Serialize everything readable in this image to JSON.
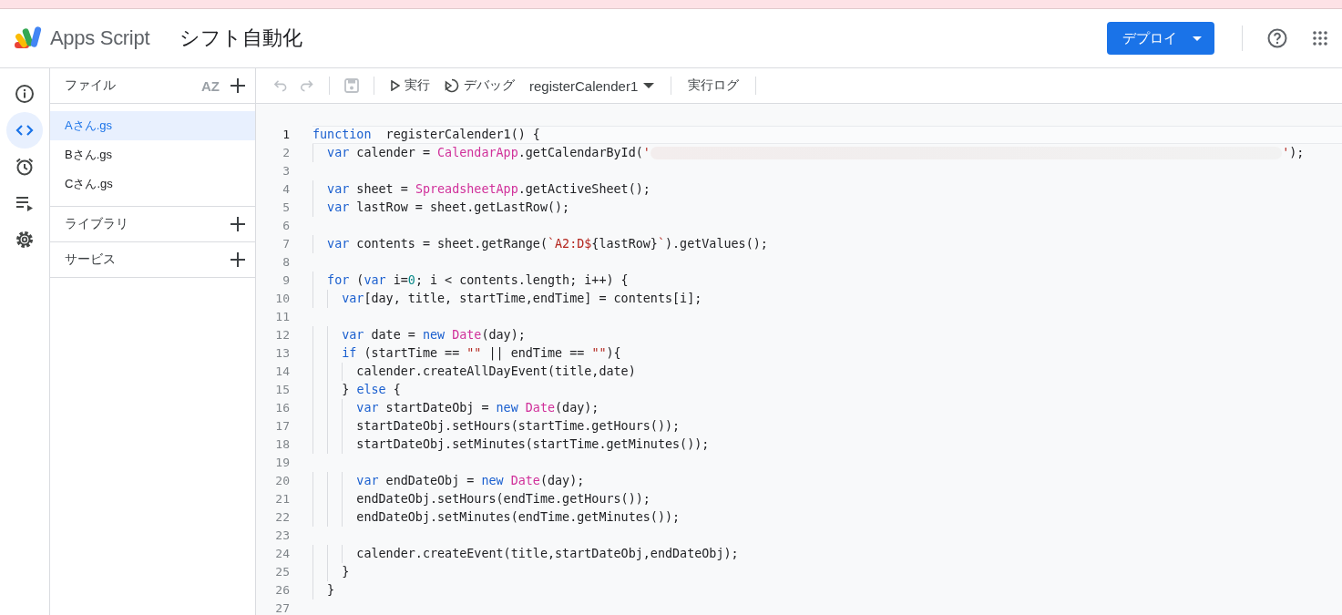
{
  "header": {
    "product": "Apps Script",
    "project_title": "シフト自動化",
    "deploy_button": "デプロイ"
  },
  "rail": [
    {
      "kind": "info",
      "selected": false
    },
    {
      "kind": "code",
      "selected": true
    },
    {
      "kind": "triggers",
      "selected": false
    },
    {
      "kind": "executions",
      "selected": false
    },
    {
      "kind": "settings",
      "selected": false
    }
  ],
  "files_panel": {
    "title": "ファイル",
    "sort_label": "AZ",
    "files": [
      {
        "name": "Aさん.gs",
        "selected": true
      },
      {
        "name": "Bさん.gs",
        "selected": false
      },
      {
        "name": "Cさん.gs",
        "selected": false
      }
    ],
    "sections": [
      {
        "title": "ライブラリ"
      },
      {
        "title": "サービス"
      }
    ]
  },
  "toolbar": {
    "run": "実行",
    "debug": "デバッグ",
    "function_select": "registerCalender1",
    "log": "実行ログ"
  },
  "editor": {
    "lines": [
      {
        "number": "1",
        "current": true,
        "tokens": [
          {
            "kind": "kw",
            "text": "function"
          },
          {
            "kind": "pl",
            "text": "  registerCalender1() {"
          }
        ]
      },
      {
        "number": "2",
        "current": false,
        "tokens": [
          {
            "kind": "kw",
            "text": "  var"
          },
          {
            "kind": "pl",
            "text": " calender = "
          },
          {
            "kind": "cls",
            "text": "CalendarApp"
          },
          {
            "kind": "pl",
            "text": ".getCalendarById("
          },
          {
            "kind": "str",
            "text": "'"
          },
          {
            "kind": "redacted"
          },
          {
            "kind": "str",
            "text": "'"
          },
          {
            "kind": "pl",
            "text": ");"
          }
        ]
      },
      {
        "number": "3",
        "current": false
      },
      {
        "number": "4",
        "current": false,
        "tokens": [
          {
            "kind": "kw",
            "text": "  var"
          },
          {
            "kind": "pl",
            "text": " sheet = "
          },
          {
            "kind": "cls",
            "text": "SpreadsheetApp"
          },
          {
            "kind": "pl",
            "text": ".getActiveSheet();"
          }
        ]
      },
      {
        "number": "5",
        "current": false,
        "tokens": [
          {
            "kind": "kw",
            "text": "  var"
          },
          {
            "kind": "pl",
            "text": " lastRow = sheet.getLastRow();"
          }
        ]
      },
      {
        "number": "6",
        "current": false
      },
      {
        "number": "7",
        "current": false,
        "tokens": [
          {
            "kind": "kw",
            "text": "  var"
          },
          {
            "kind": "pl",
            "text": " contents = sheet.getRange("
          },
          {
            "kind": "str",
            "text": "`A2:D$"
          },
          {
            "kind": "pl",
            "text": "{lastRow}"
          },
          {
            "kind": "str",
            "text": "`"
          },
          {
            "kind": "pl",
            "text": ").getValues();"
          }
        ]
      },
      {
        "number": "8",
        "current": false
      },
      {
        "number": "9",
        "current": false,
        "tokens": [
          {
            "kind": "kw",
            "text": "  for"
          },
          {
            "kind": "pl",
            "text": " ("
          },
          {
            "kind": "kw",
            "text": "var"
          },
          {
            "kind": "pl",
            "text": " i="
          },
          {
            "kind": "num",
            "text": "0"
          },
          {
            "kind": "pl",
            "text": "; i < contents.length; i++) {"
          }
        ]
      },
      {
        "number": "10",
        "current": false,
        "tokens": [
          {
            "kind": "kw",
            "text": "    var"
          },
          {
            "kind": "pl",
            "text": "[day, title, startTime,endTime] = contents[i];"
          }
        ]
      },
      {
        "number": "11",
        "current": false
      },
      {
        "number": "12",
        "current": false,
        "tokens": [
          {
            "kind": "kw",
            "text": "    var"
          },
          {
            "kind": "pl",
            "text": " date = "
          },
          {
            "kind": "kw",
            "text": "new "
          },
          {
            "kind": "cls",
            "text": "Date"
          },
          {
            "kind": "pl",
            "text": "(day);"
          }
        ]
      },
      {
        "number": "13",
        "current": false,
        "tokens": [
          {
            "kind": "kw",
            "text": "    if"
          },
          {
            "kind": "pl",
            "text": " (startTime == "
          },
          {
            "kind": "str",
            "text": "\"\""
          },
          {
            "kind": "pl",
            "text": " || endTime == "
          },
          {
            "kind": "str",
            "text": "\"\""
          },
          {
            "kind": "pl",
            "text": "){"
          }
        ]
      },
      {
        "number": "14",
        "current": false,
        "tokens": [
          {
            "kind": "pl",
            "text": "      calender.createAllDayEvent(title,date)"
          }
        ]
      },
      {
        "number": "15",
        "current": false,
        "tokens": [
          {
            "kind": "pl",
            "text": "    } "
          },
          {
            "kind": "kw",
            "text": "else"
          },
          {
            "kind": "pl",
            "text": " {"
          }
        ]
      },
      {
        "number": "16",
        "current": false,
        "tokens": [
          {
            "kind": "kw",
            "text": "      var"
          },
          {
            "kind": "pl",
            "text": " startDateObj = "
          },
          {
            "kind": "kw",
            "text": "new "
          },
          {
            "kind": "cls",
            "text": "Date"
          },
          {
            "kind": "pl",
            "text": "(day);"
          }
        ]
      },
      {
        "number": "17",
        "current": false,
        "tokens": [
          {
            "kind": "pl",
            "text": "      startDateObj.setHours(startTime.getHours());"
          }
        ]
      },
      {
        "number": "18",
        "current": false,
        "tokens": [
          {
            "kind": "pl",
            "text": "      startDateObj.setMinutes(startTime.getMinutes());"
          }
        ]
      },
      {
        "number": "19",
        "current": false
      },
      {
        "number": "20",
        "current": false,
        "tokens": [
          {
            "kind": "kw",
            "text": "      var"
          },
          {
            "kind": "pl",
            "text": " endDateObj = "
          },
          {
            "kind": "kw",
            "text": "new "
          },
          {
            "kind": "cls",
            "text": "Date"
          },
          {
            "kind": "pl",
            "text": "(day);"
          }
        ]
      },
      {
        "number": "21",
        "current": false,
        "tokens": [
          {
            "kind": "pl",
            "text": "      endDateObj.setHours(endTime.getHours());"
          }
        ]
      },
      {
        "number": "22",
        "current": false,
        "tokens": [
          {
            "kind": "pl",
            "text": "      endDateObj.setMinutes(endTime.getMinutes());"
          }
        ]
      },
      {
        "number": "23",
        "current": false
      },
      {
        "number": "24",
        "current": false,
        "tokens": [
          {
            "kind": "pl",
            "text": "      calender.createEvent(title,startDateObj,endDateObj);"
          }
        ]
      },
      {
        "number": "25",
        "current": false,
        "tokens": [
          {
            "kind": "pl",
            "text": "    }"
          }
        ]
      },
      {
        "number": "26",
        "current": false,
        "tokens": [
          {
            "kind": "pl",
            "text": "  }"
          }
        ]
      },
      {
        "number": "27",
        "current": false
      }
    ]
  }
}
